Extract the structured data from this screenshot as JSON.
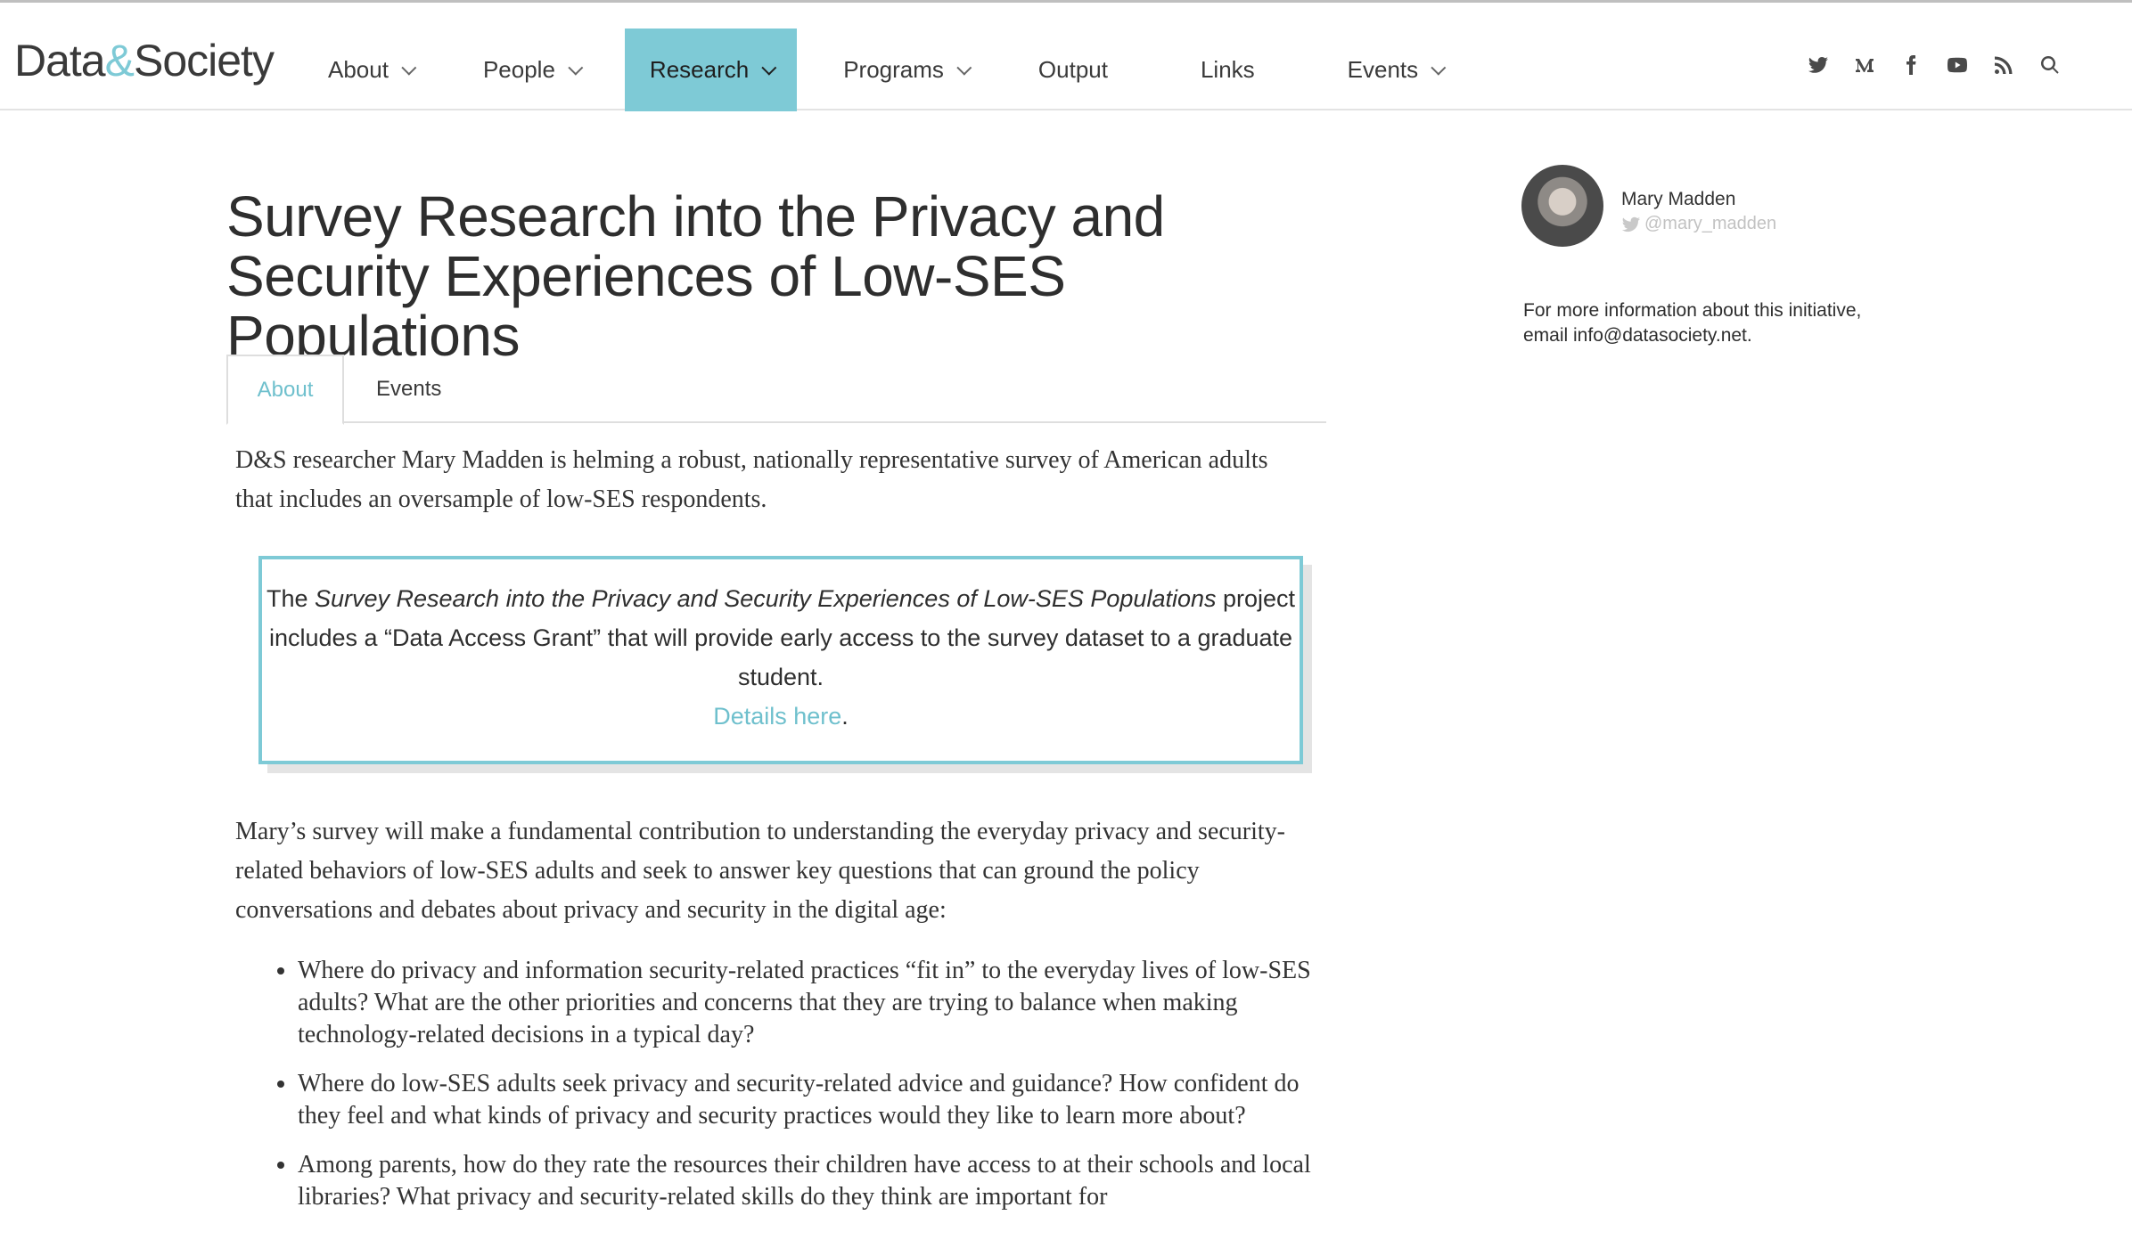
{
  "brand": {
    "logo_part1": "Data",
    "logo_amp": "&",
    "logo_part2": "Society",
    "accent": "#7ecad6"
  },
  "nav": {
    "items": [
      {
        "label": "About",
        "dropdown": true
      },
      {
        "label": "People",
        "dropdown": true
      },
      {
        "label": "Research",
        "dropdown": true,
        "active": true
      },
      {
        "label": "Programs",
        "dropdown": true
      },
      {
        "label": "Output",
        "dropdown": false
      },
      {
        "label": "Links",
        "dropdown": false
      },
      {
        "label": "Events",
        "dropdown": true
      }
    ],
    "social_icons": [
      "twitter-icon",
      "medium-icon",
      "facebook-icon",
      "youtube-icon",
      "rss-icon",
      "search-icon"
    ]
  },
  "page": {
    "title": "Survey Research into the Privacy and Security Experiences of Low-SES Populations",
    "tabs": [
      {
        "label": "About",
        "active": true
      },
      {
        "label": "Events",
        "active": false
      }
    ],
    "intro": "D&S researcher Mary Madden is helming a robust, nationally representative survey of American adults that includes an oversample of low-SES respondents.",
    "callout": {
      "prefix": "The ",
      "italic": "Survey Research into the Privacy and Security Experiences of Low-SES Populations",
      "suffix": " project includes a “Data Access Grant” that will provide early access to the survey dataset to a graduate student.",
      "link": "Details here",
      "link_suffix": "."
    },
    "paragraph2": "Mary’s survey will make a fundamental contribution to understanding the everyday privacy and security-related behaviors of low-SES adults and seek to answer key questions that can ground the policy conversations and debates about privacy and security in the digital age:",
    "bullets": [
      "Where do privacy and information security-related practices “fit in” to the everyday lives of low-SES adults? What are the other priorities and concerns that they are trying to balance when making technology-related decisions in a typical day?",
      "Where do low-SES adults seek privacy and security-related advice and guidance? How confident do they feel and what kinds of privacy and security practices would they like to learn more about?",
      "Among parents, how do they rate the resources their children have access to at their schools and local libraries? What privacy and security-related skills do they think are important for"
    ]
  },
  "sidebar": {
    "author_name": "Mary Madden",
    "author_handle": "@mary_madden",
    "info": "For more information about this initiative, email info@datasociety.net."
  }
}
